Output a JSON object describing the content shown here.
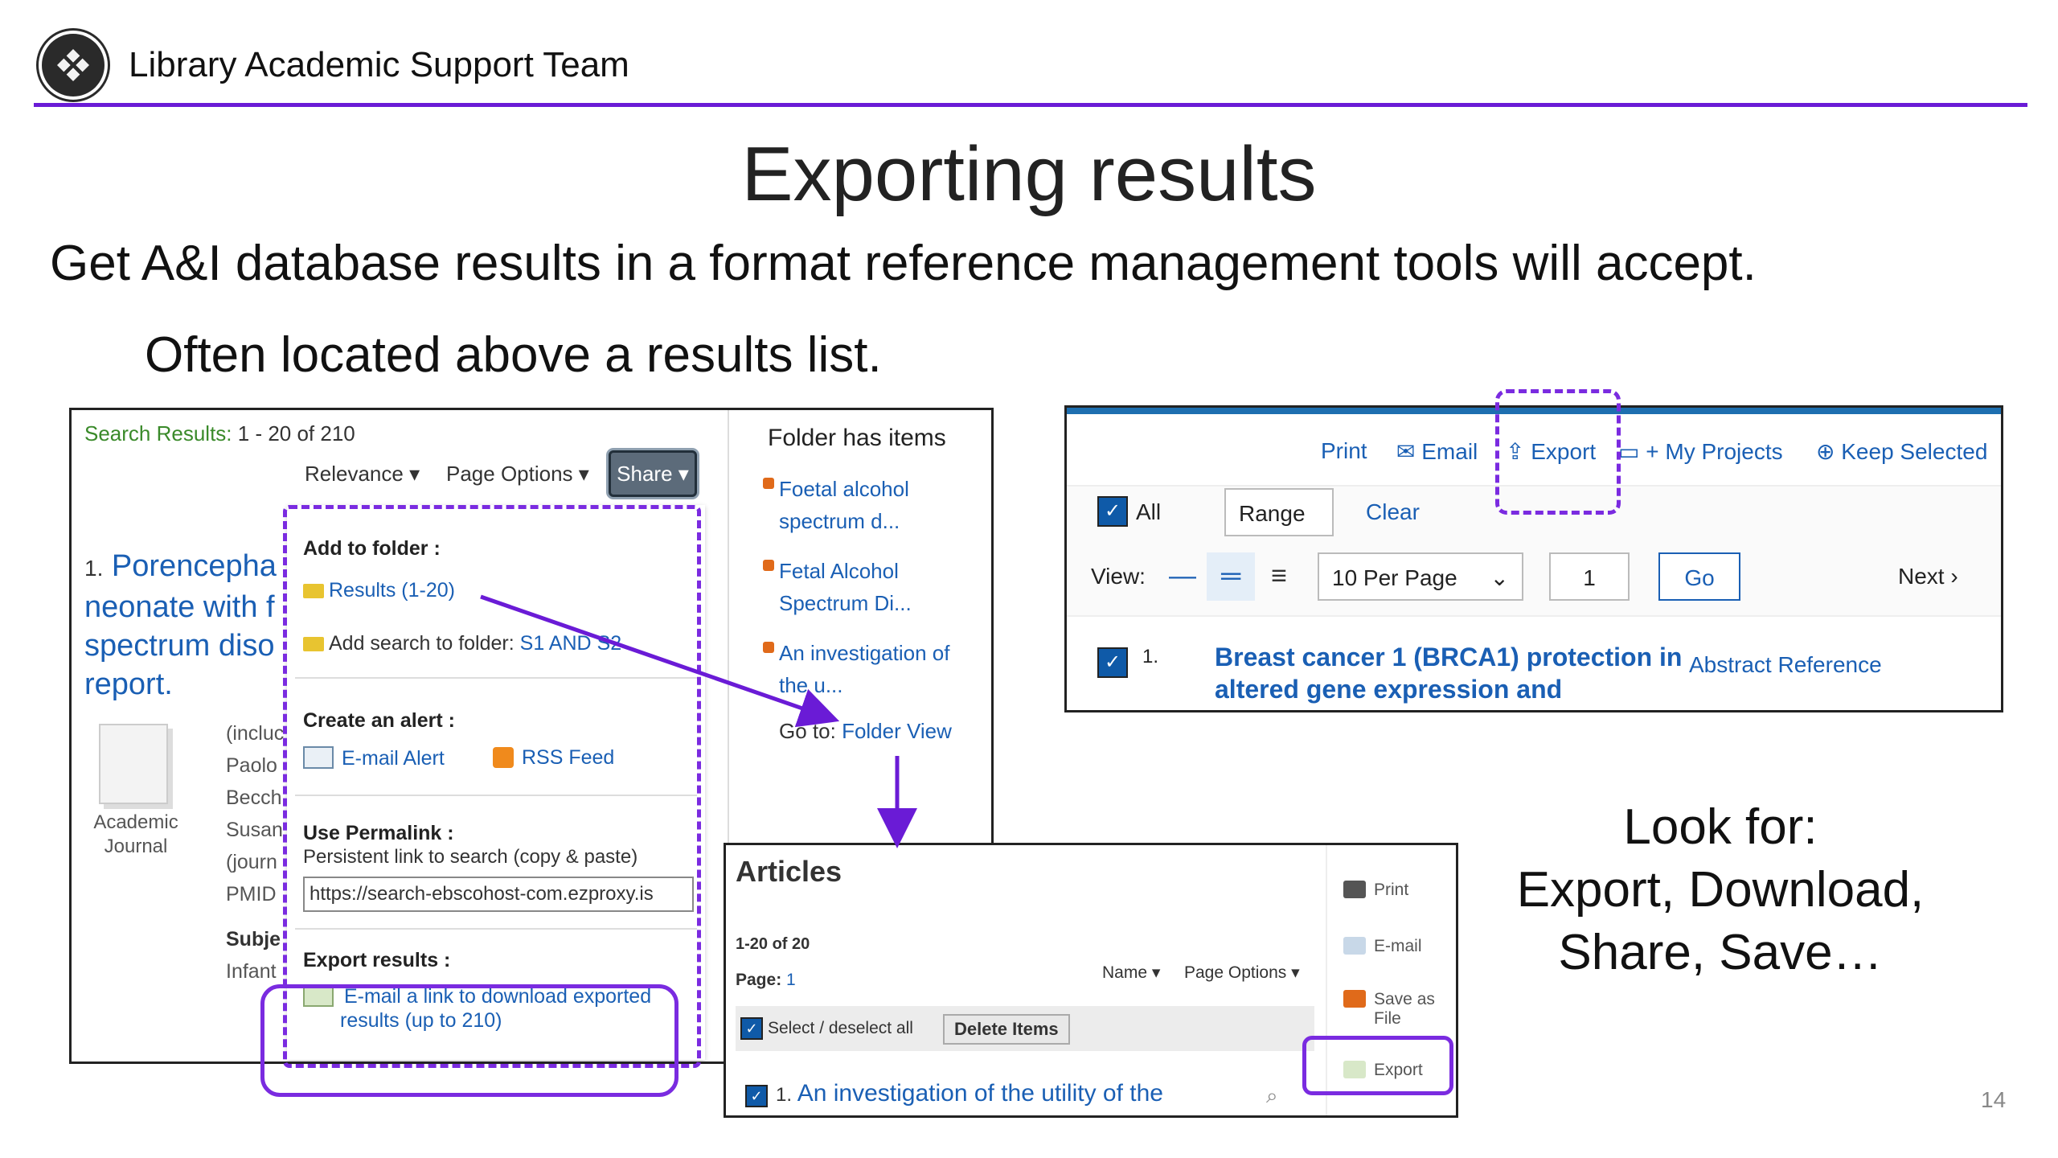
{
  "header": {
    "org": "Library Academic Support Team",
    "logo_icon": "university-crest-icon"
  },
  "slide": {
    "title": "Exporting results",
    "line1": "Get A&I database results in a format reference management tools will accept.",
    "line2": "Often located above a results list.",
    "look_for": [
      "Look for:",
      "Export, Download,",
      "Share, Save…"
    ],
    "page_number": "14"
  },
  "ebsco": {
    "results_label": "Search Results:",
    "results_range": "1 - 20 of 210",
    "sort": "Relevance ▾",
    "page_options": "Page Options ▾",
    "share": "Share ▾",
    "folder_title": "Folder has items",
    "folder_items": [
      [
        "Foetal alcohol",
        "spectrum d..."
      ],
      [
        "Fetal Alcohol",
        "Spectrum Di..."
      ],
      [
        "An investigation of",
        "the u..."
      ]
    ],
    "goto_label": "Go to:",
    "goto_link": "Folder View",
    "article_number": "1.",
    "article_title": [
      "Porencepha",
      "neonate with f",
      "spectrum diso",
      "report."
    ],
    "journal_label": [
      "Academic",
      "Journal"
    ],
    "meta": [
      "(incluc",
      "Paolo",
      "Becch",
      "Susan",
      "(journ",
      "PMID"
    ],
    "subject_label": "Subje",
    "subject_value": "Infant",
    "menu": {
      "add_to_folder": "Add to folder :",
      "results_link": "Results (1-20)",
      "add_search_text": "Add search to folder:",
      "add_search_link": "S1 AND S2",
      "create_alert": "Create an alert :",
      "email_alert": "E-mail Alert",
      "rss_feed": "RSS Feed",
      "permalink_head": "Use Permalink :",
      "permalink_desc": "Persistent link to search (copy & paste)",
      "permalink_url": "https://search-ebscohost-com.ezproxy.is",
      "export_head": "Export results :",
      "export_link": [
        "E-mail a link to download exported",
        "results (up to 210)"
      ]
    }
  },
  "proquest": {
    "print": "Print",
    "email": "Email",
    "export": "Export",
    "my_projects": "+ My Projects",
    "keep_selected": "Keep Selected",
    "all": "All",
    "range": "Range",
    "clear": "Clear",
    "view_label": "View:",
    "per_page": "10 Per Page",
    "page_value": "1",
    "go": "Go",
    "next": "Next",
    "result_number": "1.",
    "result_title": [
      "Breast cancer 1 (BRCA1) protection in",
      "altered gene expression and"
    ],
    "result_links": "Abstract Reference"
  },
  "folder_view": {
    "title": "Articles",
    "range": "1-20 of 20",
    "page_label": "Page:",
    "page_value": "1",
    "name_sort": "Name ▾",
    "page_options": "Page Options ▾",
    "select_all": "Select / deselect all",
    "delete_items": "Delete Items",
    "item_number": "1.",
    "item_title": "An investigation of the utility of the",
    "side": {
      "print": "Print",
      "email": "E-mail",
      "save": [
        "Save as",
        "File"
      ],
      "export": "Export"
    }
  },
  "colors": {
    "accent": "#6a1bd6",
    "highlight": "#7a2be0",
    "link": "#1a5fb4"
  }
}
